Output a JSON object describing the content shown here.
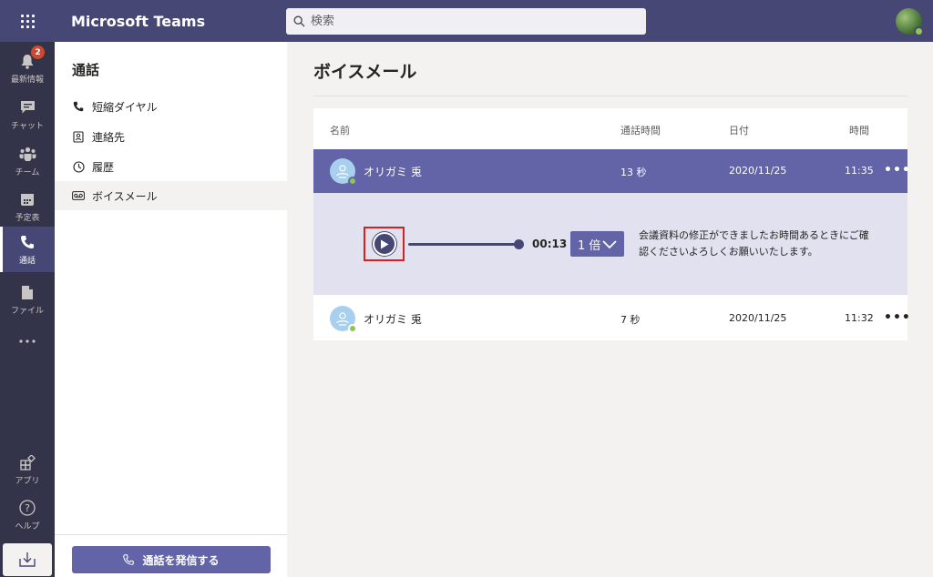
{
  "app": {
    "title": "Microsoft Teams"
  },
  "search": {
    "placeholder": "検索"
  },
  "rail": {
    "items": [
      {
        "label": "最新情報",
        "icon": "bell-icon",
        "badge": "2"
      },
      {
        "label": "チャット",
        "icon": "chat-icon"
      },
      {
        "label": "チーム",
        "icon": "teams-icon"
      },
      {
        "label": "予定表",
        "icon": "calendar-icon"
      },
      {
        "label": "通話",
        "icon": "phone-icon",
        "active": true
      },
      {
        "label": "ファイル",
        "icon": "file-icon"
      },
      {
        "label": "",
        "icon": "more-apps-icon"
      }
    ],
    "bottom": [
      {
        "label": "アプリ",
        "icon": "apps-icon"
      },
      {
        "label": "ヘルプ",
        "icon": "help-icon"
      }
    ]
  },
  "left_panel": {
    "title": "通話",
    "items": [
      {
        "label": "短縮ダイヤル",
        "icon": "phone-icon"
      },
      {
        "label": "連絡先",
        "icon": "contacts-icon"
      },
      {
        "label": "履歴",
        "icon": "clock-icon"
      },
      {
        "label": "ボイスメール",
        "icon": "voicemail-icon",
        "selected": true
      }
    ],
    "call_button": "通話を発信する"
  },
  "main": {
    "title": "ボイスメール",
    "columns": {
      "name": "名前",
      "duration": "通話時間",
      "date": "日付",
      "time": "時間"
    },
    "rows": [
      {
        "name": "オリガミ 兎",
        "duration": "13 秒",
        "date": "2020/11/25",
        "time": "11:35"
      },
      {
        "name": "オリガミ 兎",
        "duration": "7 秒",
        "date": "2020/11/25",
        "time": "11:32"
      }
    ],
    "player": {
      "duration": "00:13",
      "speed": "1 倍",
      "progress": 1.0,
      "transcript": "会議資料の修正ができましたお時間あるときにご確認くださいよろしくお願いいたします。"
    },
    "more_glyph": "•••"
  },
  "colors": {
    "brand": "#6264a7",
    "topbar": "#464775",
    "rail": "#33344a",
    "highlight": "#d92020"
  }
}
